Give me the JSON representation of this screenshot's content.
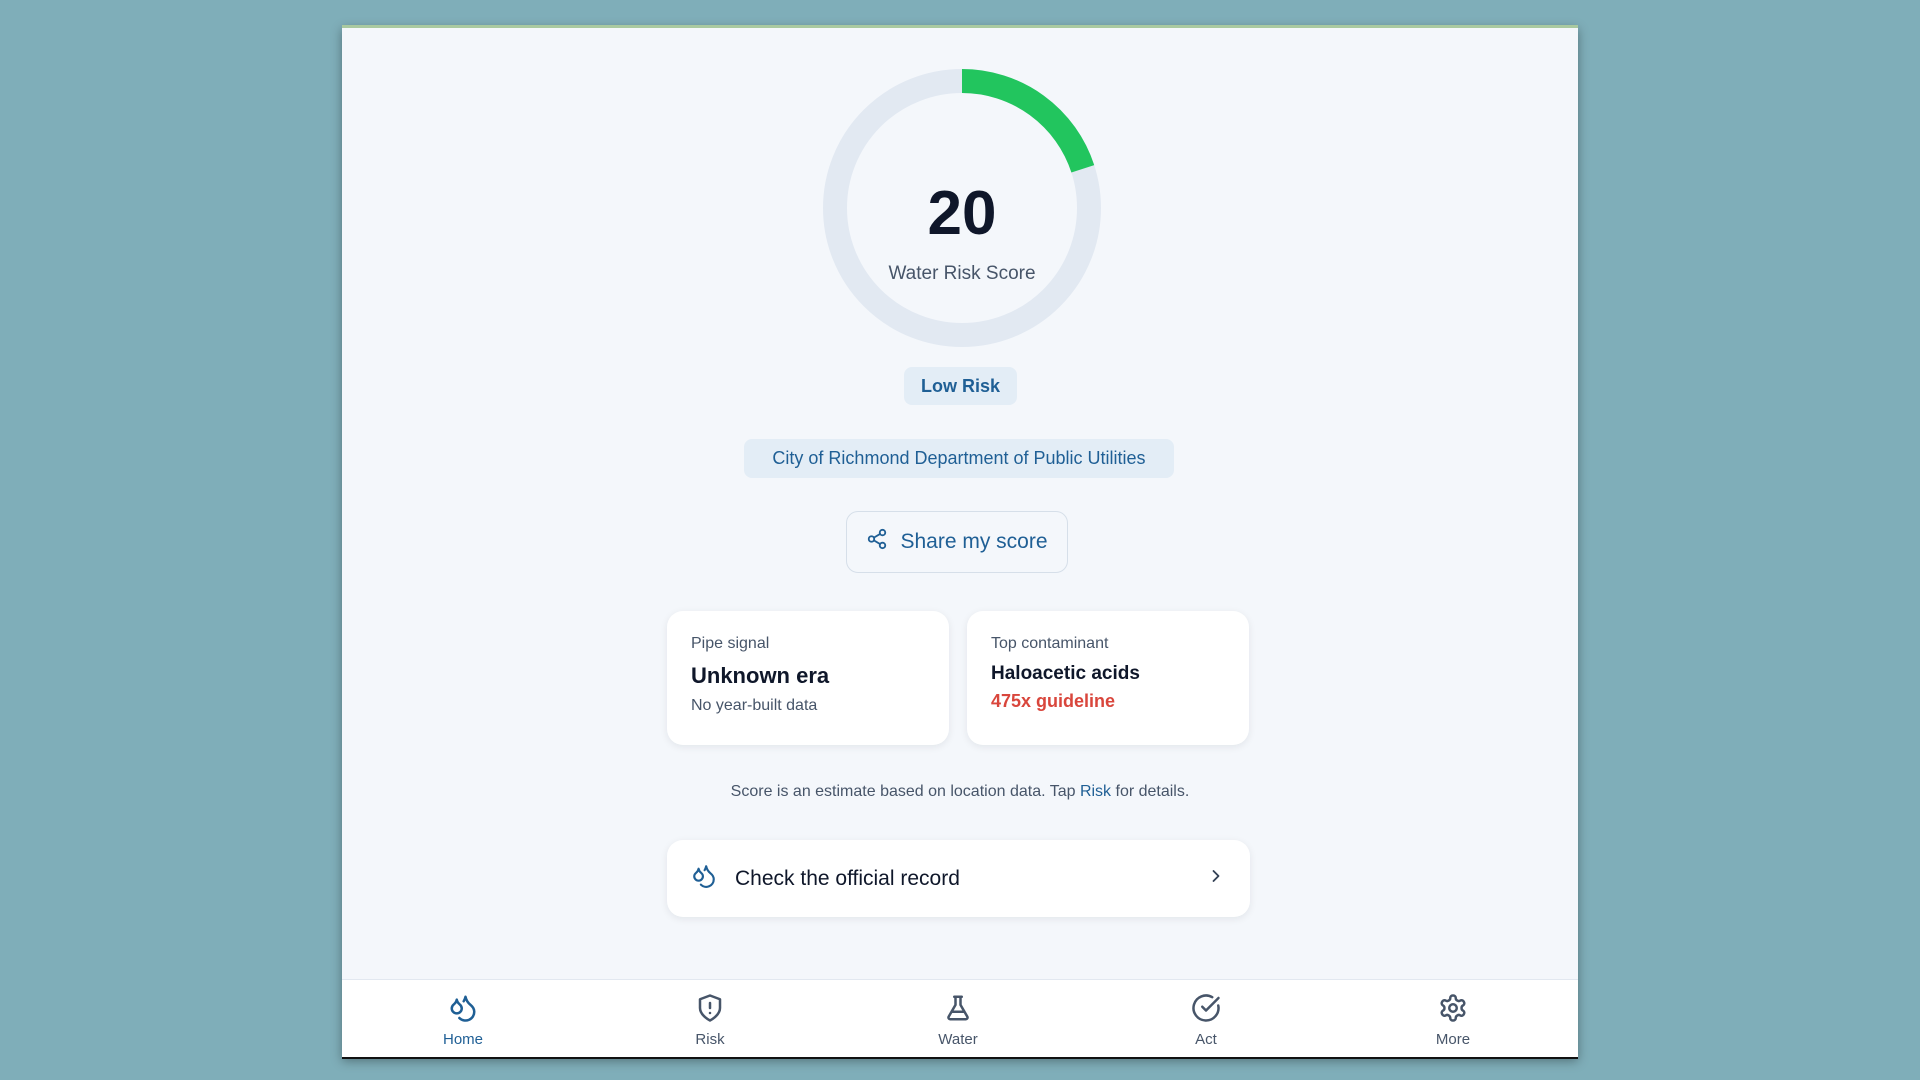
{
  "score": {
    "value": "20",
    "label": "Water Risk Score",
    "progress_fraction": 0.2,
    "progress_color": "#22c55e",
    "track_color": "#e2e9f2"
  },
  "risk_level": "Low Risk",
  "utility": "City of Richmond Department of Public Utilities",
  "share_button": {
    "label": "Share my score",
    "icon": "share-icon"
  },
  "cards": {
    "pipe": {
      "title": "Pipe signal",
      "value": "Unknown era",
      "subtitle": "No year-built data"
    },
    "contaminant": {
      "title": "Top contaminant",
      "value": "Haloacetic acids",
      "warning": "475x guideline",
      "warning_color": "#d9463c"
    }
  },
  "disclaimer": {
    "prefix": "Score is an estimate based on location data. Tap ",
    "link": "Risk",
    "suffix": " for details."
  },
  "official_record": {
    "label": "Check the official record",
    "icon": "droplets-icon",
    "chevron": "chevron-right-icon"
  },
  "nav": {
    "active": "Home",
    "items": [
      {
        "label": "Home",
        "icon": "droplets-icon"
      },
      {
        "label": "Risk",
        "icon": "shield-alert-icon"
      },
      {
        "label": "Water",
        "icon": "flask-icon"
      },
      {
        "label": "Act",
        "icon": "check-circle-icon"
      },
      {
        "label": "More",
        "icon": "gear-icon"
      }
    ]
  },
  "colors": {
    "accent": "#1f5f95",
    "background": "#f4f7fb",
    "page_background": "#7faeb9"
  }
}
